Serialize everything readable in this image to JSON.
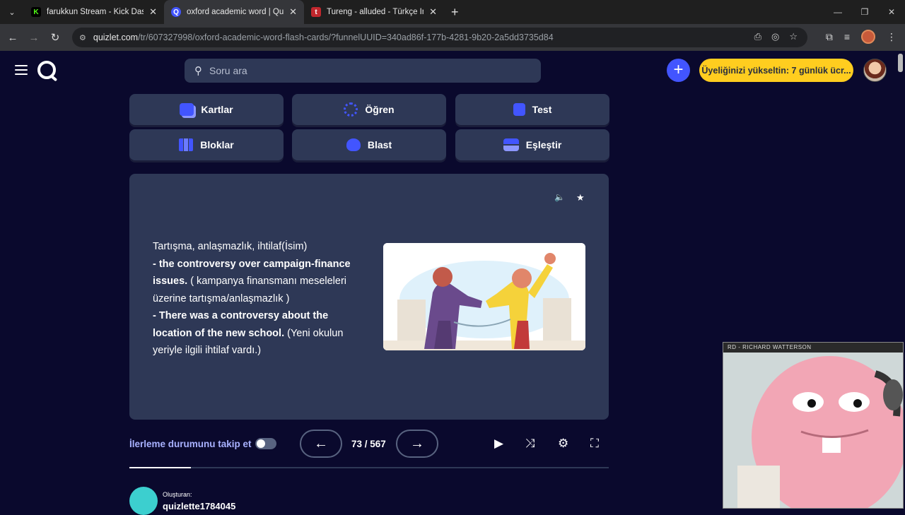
{
  "browser": {
    "tabs": [
      {
        "title": "farukkun Stream - Kick Dashboa",
        "fav_color": "#53fc18",
        "fav_char": "K",
        "active": false
      },
      {
        "title": "oxford academic word | Quizlet",
        "fav_color": "#4255ff",
        "fav_char": "Q",
        "active": true
      },
      {
        "title": "Tureng - alluded - Türkçe İngiliz",
        "fav_color": "#c1272d",
        "fav_char": "t",
        "active": false
      }
    ],
    "url_host": "quizlet.com",
    "url_path": "/tr/607327998/oxford-academic-word-flash-cards/?funnelUUID=340ad86f-177b-4281-9b20-2a5dd3735d84"
  },
  "header": {
    "search_placeholder": "Soru ara",
    "upgrade_label": "Üyeliğinizi yükseltin: 7 günlük ücr..."
  },
  "modes": [
    {
      "label": "Kartlar",
      "icon": "cards-icon",
      "color": "#4255ff"
    },
    {
      "label": "Öğren",
      "icon": "learn-icon",
      "color": "#4255ff"
    },
    {
      "label": "Test",
      "icon": "test-icon",
      "color": "#4255ff"
    },
    {
      "label": "Bloklar",
      "icon": "blocks-icon",
      "color": "#4255ff"
    },
    {
      "label": "Blast",
      "icon": "blast-icon",
      "color": "#4255ff"
    },
    {
      "label": "Eşleştir",
      "icon": "match-icon",
      "color": "#4255ff"
    }
  ],
  "card": {
    "line1": "Tartışma, anlaşmazlık, ihtilaf(İsim)",
    "ex1_bold": "- the controversy over campaign-finance issues.",
    "ex1_tr": " ( kampanya finansmanı meseleleri üzerine tartışma/anlaşmazlık )",
    "ex2_bold": "- There was a controversy about the location of the new school.",
    "ex2_tr": " (Yeni okulun yeriyle ilgili ihtilaf vardı.)"
  },
  "controls": {
    "track_label": "İlerleme durumunu takip et",
    "counter": "73 / 567",
    "progress_fraction": 0.1287
  },
  "creator": {
    "label": "Oluşturan:",
    "name": "quizlette1784045"
  },
  "webcam": {
    "caption": "RD - RICHARD WATTERSON"
  }
}
